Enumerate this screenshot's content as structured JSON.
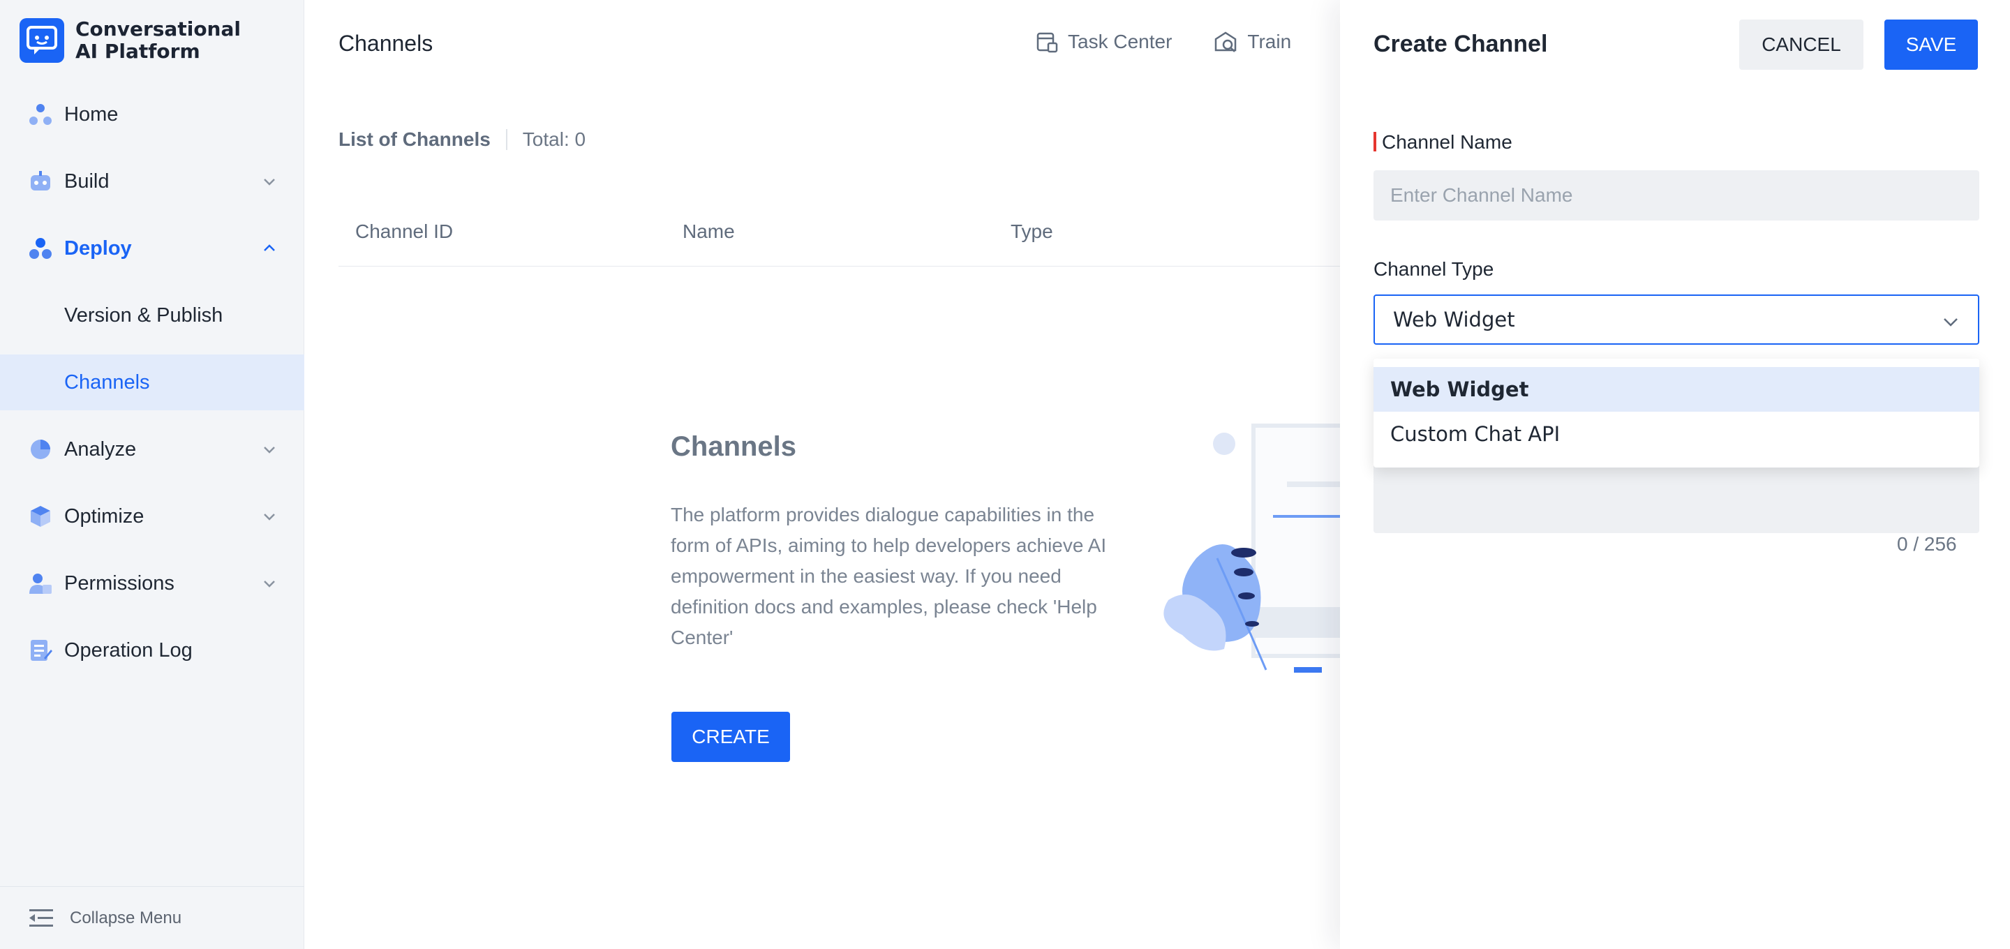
{
  "brand": {
    "name_line1": "Conversational",
    "name_line2": "AI Platform"
  },
  "sidebar": {
    "items": [
      {
        "label": "Home",
        "icon": "home-icon"
      },
      {
        "label": "Build",
        "icon": "robot-icon"
      },
      {
        "label": "Deploy",
        "icon": "deploy-icon"
      },
      {
        "label": "Version & Publish"
      },
      {
        "label": "Channels"
      },
      {
        "label": "Analyze",
        "icon": "pie-chart-icon"
      },
      {
        "label": "Optimize",
        "icon": "cube-icon"
      },
      {
        "label": "Permissions",
        "icon": "users-icon"
      },
      {
        "label": "Operation Log",
        "icon": "log-icon"
      }
    ],
    "collapse_label": "Collapse Menu"
  },
  "header": {
    "title": "Channels",
    "actions": [
      {
        "label": "Task Center",
        "icon": "task-center-icon"
      },
      {
        "label": "Train",
        "icon": "train-icon"
      }
    ]
  },
  "list": {
    "title": "List of Channels",
    "total": "Total: 0",
    "columns": [
      "Channel ID",
      "Name",
      "Type"
    ]
  },
  "empty_state": {
    "title": "Channels",
    "description": "The platform provides dialogue capabilities in the form of APIs, aiming to help developers achieve AI empowerment in the easiest way. If you need definition docs and examples, please check 'Help Center'",
    "button": "CREATE"
  },
  "drawer": {
    "title": "Create Channel",
    "cancel": "CANCEL",
    "save": "SAVE",
    "name_label": "Channel Name",
    "name_placeholder": "Enter Channel Name",
    "type_label": "Channel Type",
    "type_value": "Web Widget",
    "options": [
      "Web Widget",
      "Custom Chat API"
    ],
    "counter": "0 / 256"
  },
  "colors": {
    "accent": "#1a64f5",
    "sidebar_bg": "#f3f5f8",
    "selected_bg": "#e2ebfb",
    "required": "#e5362f"
  }
}
